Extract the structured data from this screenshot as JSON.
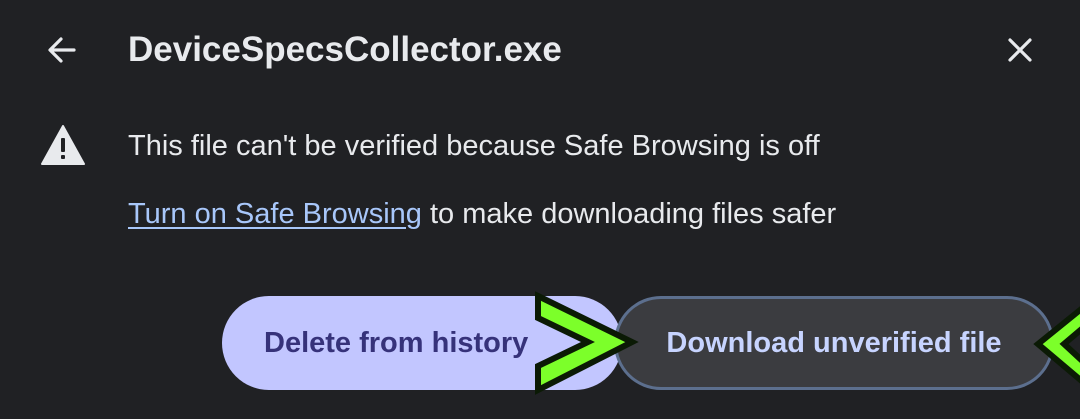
{
  "dialog": {
    "title": "DeviceSpecsCollector.exe",
    "back_icon": "arrow-left-icon",
    "close_icon": "close-icon"
  },
  "warning": {
    "icon": "warning-triangle-icon",
    "text": "This file can't be verified because Safe Browsing is off"
  },
  "info": {
    "link_text": "Turn on Safe Browsing",
    "rest_text": " to make downloading files safer"
  },
  "actions": {
    "delete_label": "Delete from history",
    "download_label": "Download unverified file"
  },
  "colors": {
    "background": "#202124",
    "text": "#e8eaed",
    "link": "#a8c7fa",
    "primary_button_bg": "#c2c6ff",
    "primary_button_text": "#36327a",
    "secondary_button_bg": "#3b3c40",
    "secondary_button_border": "#5c6f8e",
    "annotation_arrow": "#7cff2a"
  }
}
